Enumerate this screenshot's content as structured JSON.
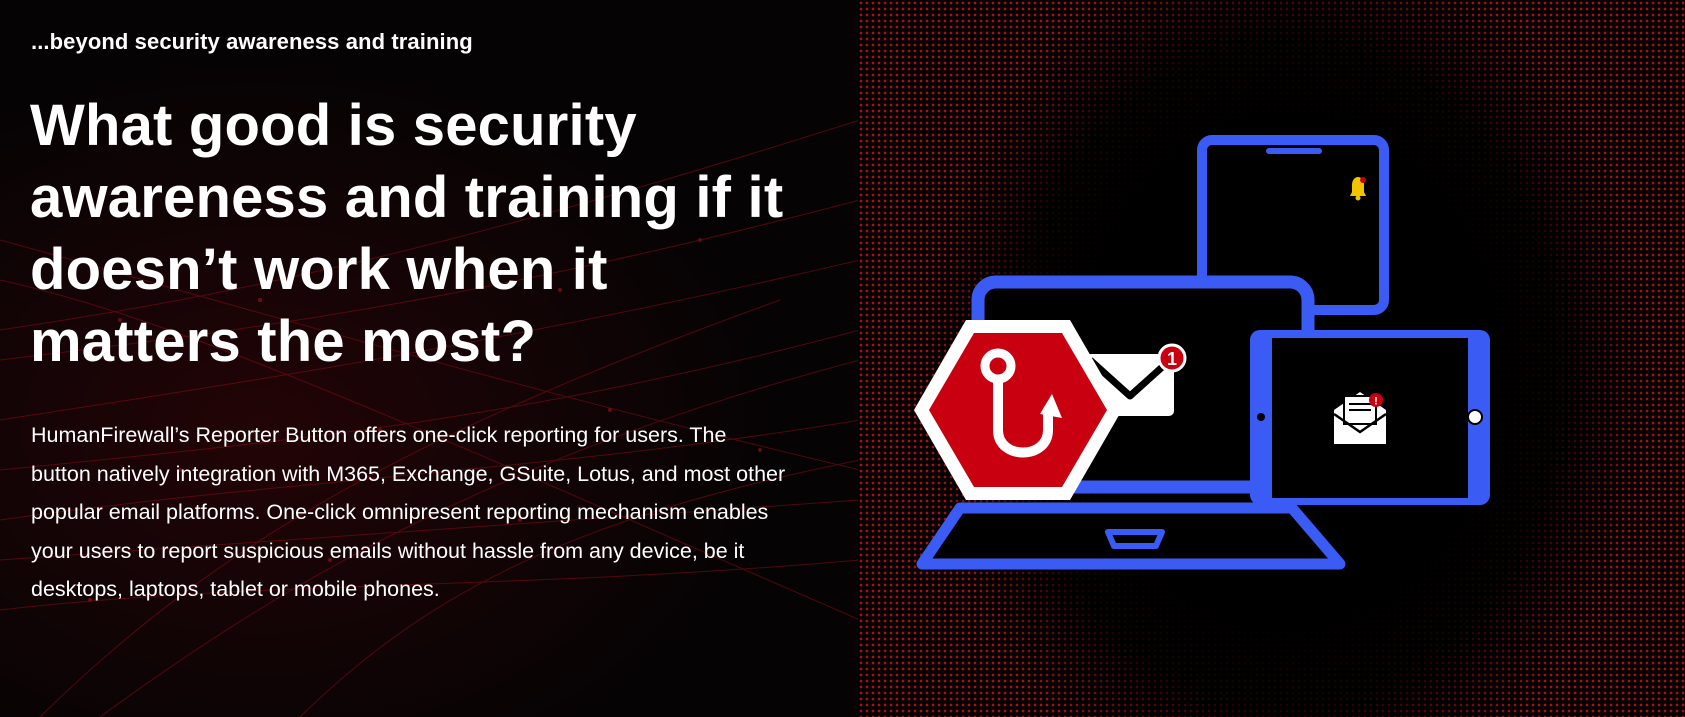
{
  "hero": {
    "eyebrow": "...beyond security awareness and training",
    "headline": "What good is security awareness and training if it doesn’t work when it matters the most?",
    "body": "HumanFirewall’s Reporter Button offers one-click reporting for users. The button natively integration with M365, Exchange, GSuite, Lotus, and most other popular email platforms. One-click omnipresent reporting mechanism enables your users to report suspicious emails without hassle from any device, be it desktops, laptops, tablet or mobile phones."
  },
  "illustration": {
    "icons": [
      "phishing-hook-icon",
      "envelope-icon",
      "bell-icon",
      "mail-alert-icon"
    ],
    "badges": {
      "laptop_mail_count": "1",
      "tablet_alert": "!"
    },
    "colors": {
      "device_outline": "#3B5BF5",
      "hook_stop": "#C8000F",
      "bell": "#F2C400",
      "background_dots": "#B91419"
    }
  }
}
